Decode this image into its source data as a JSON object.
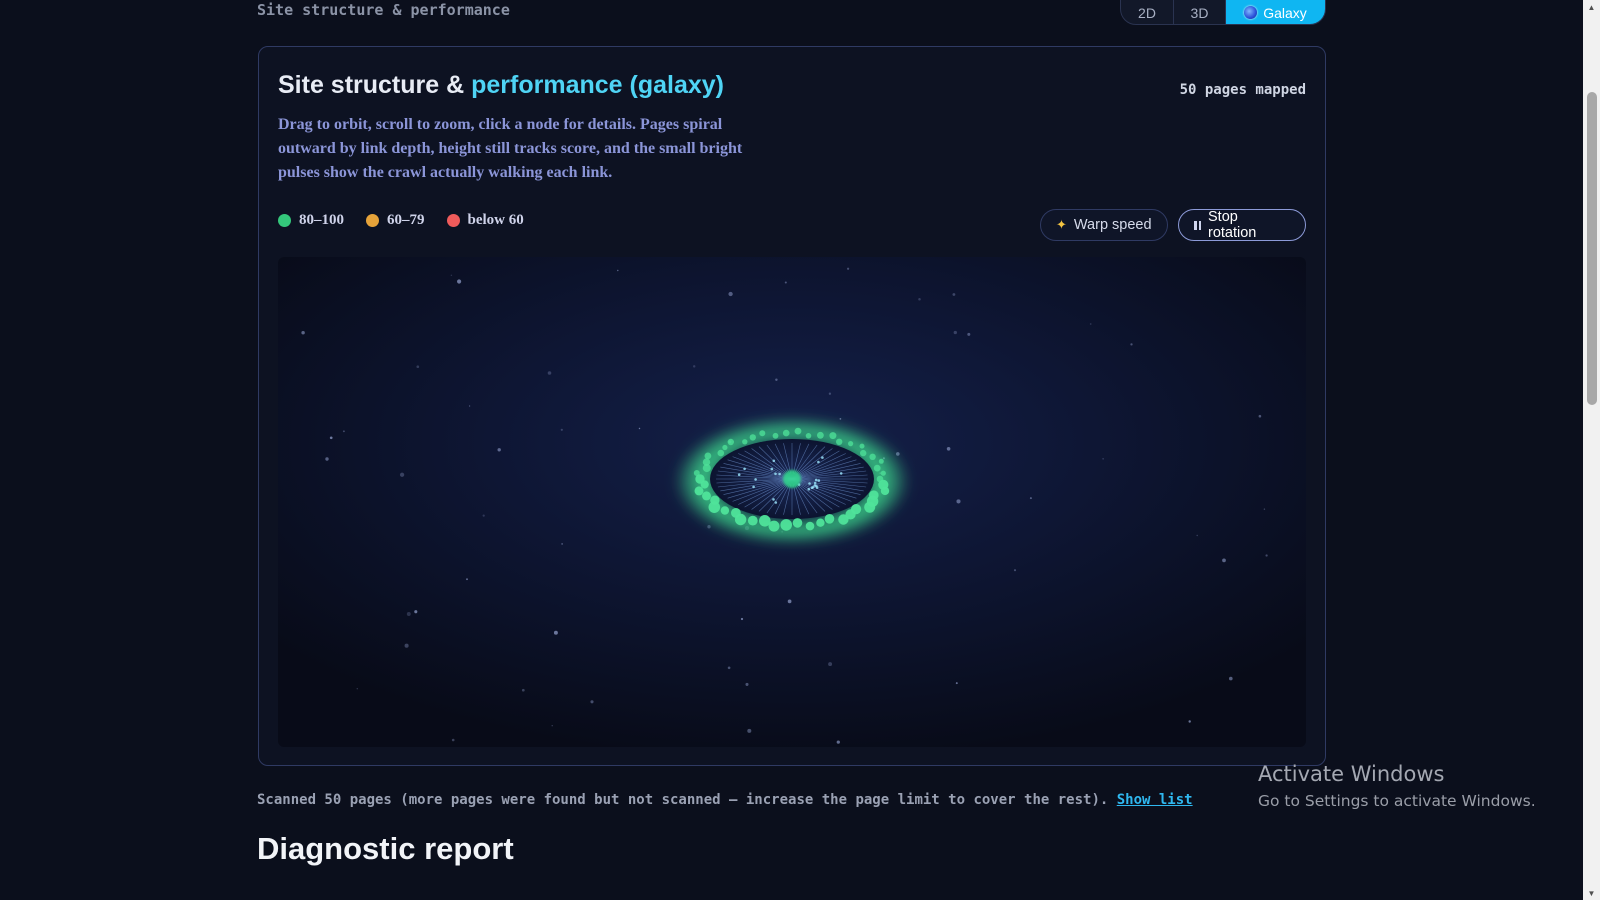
{
  "header": {
    "section_label": "Site structure & performance",
    "view_modes": [
      "2D",
      "3D",
      "Galaxy"
    ],
    "active_view": "Galaxy"
  },
  "card": {
    "title_main": "Site structure & ",
    "title_accent": "performance (galaxy)",
    "pages_mapped": "50 pages mapped",
    "description": "Drag to orbit, scroll to zoom, click a node for details. Pages spiral outward by link depth, height still tracks score, and the small bright pulses show the crawl actually walking each link.",
    "legend": [
      {
        "label": "80–100",
        "color": "#34c77b"
      },
      {
        "label": "60–79",
        "color": "#e6a33a"
      },
      {
        "label": "below 60",
        "color": "#ef5b5b"
      }
    ],
    "controls": {
      "warp_label": "Warp speed",
      "stop_label": "Stop rotation"
    },
    "galaxy": {
      "node_color": "#4fe39a",
      "glow_color": "#3ee08f",
      "node_count": 50
    }
  },
  "footer": {
    "scan_note": "Scanned 50 pages (more pages were found but not scanned — increase the page limit to cover the rest). ",
    "show_list_label": "Show list",
    "report_heading": "Diagnostic report"
  },
  "watermark": {
    "line1": "Activate Windows",
    "line2": "Go to Settings to activate Windows."
  },
  "colors": {
    "accent": "#4fd4f5",
    "toggle_active": "#0fb6f2",
    "background": "#0b0f1c"
  }
}
